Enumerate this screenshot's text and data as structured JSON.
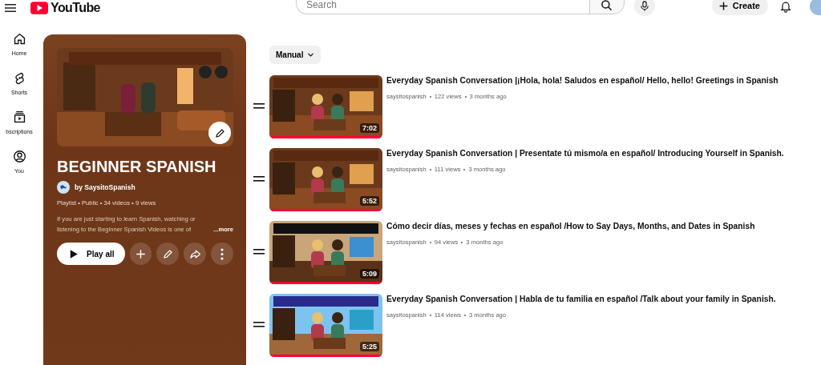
{
  "header": {
    "logo_text": "YouTube",
    "search": {
      "placeholder": "Search"
    },
    "create_label": "Create"
  },
  "nav": [
    {
      "label": "Home",
      "selected": false
    },
    {
      "label": "Shorts",
      "selected": false
    },
    {
      "label": "bscriptions",
      "selected": false
    },
    {
      "label": "You",
      "selected": false
    }
  ],
  "playlist": {
    "title": "BEGINNER SPANISH",
    "owner": "by SaysitoSpanish",
    "meta": "Playlist • Public • 34 videos • 9 views",
    "description_lines": [
      "If you are just starting to learn Spanish, watching or",
      "listening to the Beginner Spanish Videos is one of"
    ],
    "more": "...more",
    "play_all": "Play all"
  },
  "sort": {
    "label": "Manual"
  },
  "videos": [
    {
      "title": "Everyday Spanish Conversation |¡Hola, hola! Saludos en español/ Hello, hello! Greetings in Spanish",
      "channel": "saysitospanish",
      "views": "122 views",
      "age": "3 months ago",
      "duration": "7:02",
      "level": 1
    },
    {
      "title": "Everyday Spanish Conversation | Presentate tú mismo/a en español/ Introducing Yourself in Spanish.",
      "channel": "saysitospanish",
      "views": "111 views",
      "age": "3 months ago",
      "duration": "5:52",
      "level": 1
    },
    {
      "title": "Cómo decir días, meses y fechas en español /How to Say Days, Months, and Dates in Spanish",
      "channel": "saysitospanish",
      "views": "94 views",
      "age": "3 months ago",
      "duration": "5:09",
      "level": 1
    },
    {
      "title": "Everyday Spanish Conversation | Habla de tu familia en español /Talk about your family in Spanish.",
      "channel": "saysitospanish",
      "views": "114 views",
      "age": "3 months ago",
      "duration": "5:25",
      "level": 1
    }
  ]
}
